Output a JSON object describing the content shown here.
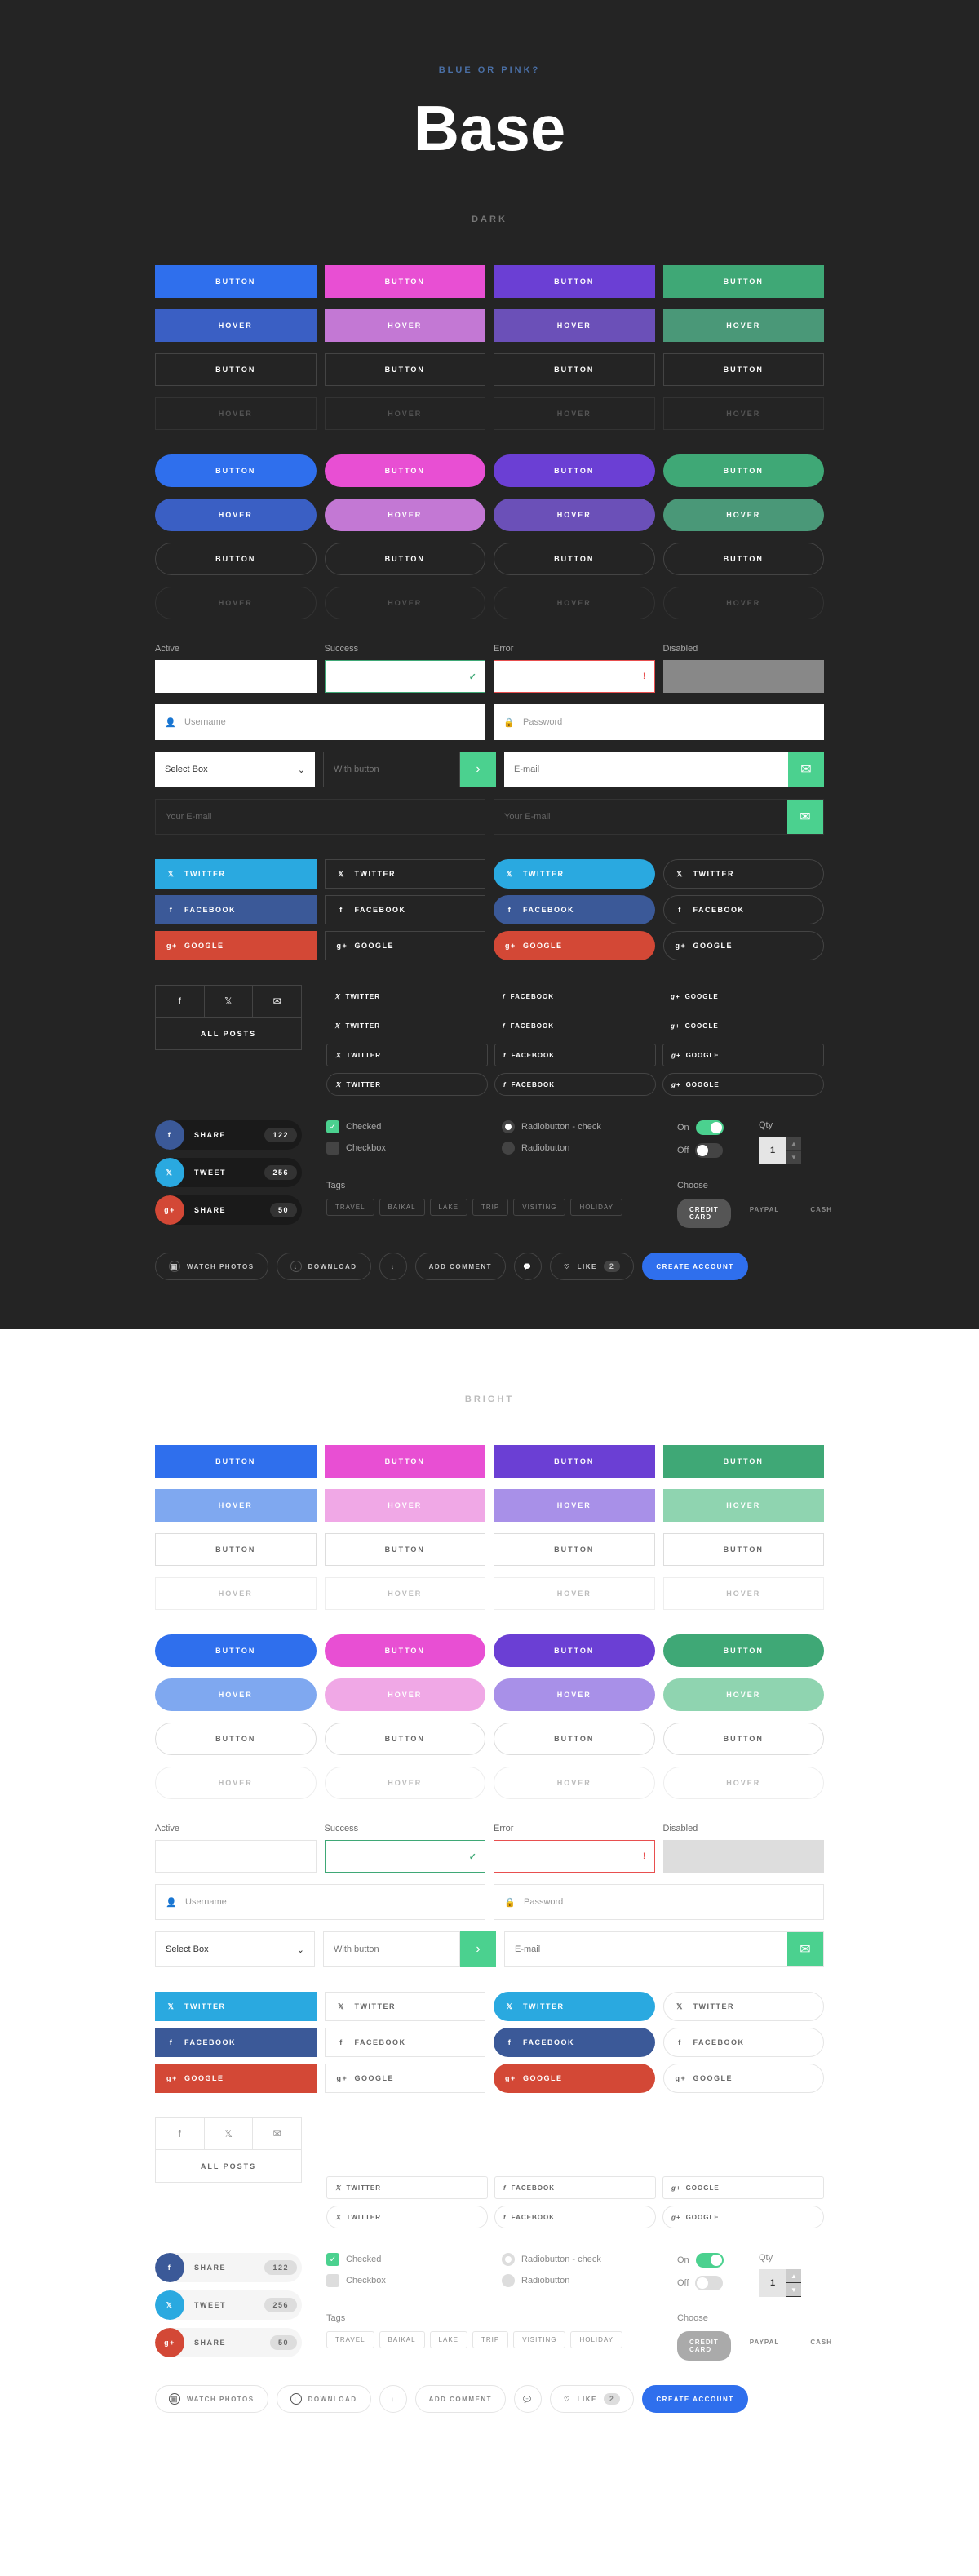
{
  "header": {
    "subtitle": "BLUE OR PINK?",
    "title": "Base"
  },
  "sections": {
    "dark": "DARK",
    "bright": "BRIGHT"
  },
  "btn": {
    "button": "BUTTON",
    "hover": "HOVER"
  },
  "inputs": {
    "labels": {
      "active": "Active",
      "success": "Success",
      "error": "Error",
      "disabled": "Disabled"
    },
    "username": "Username",
    "password": "Password",
    "select": "Select Box",
    "with_button": "With button",
    "email": "E-mail",
    "your_email": "Your E-mail"
  },
  "social": {
    "twitter": "TWITTER",
    "facebook": "FACEBOOK",
    "google": "GOOGLE"
  },
  "tabs": {
    "all_posts": "ALL POSTS"
  },
  "share": {
    "share": "SHARE",
    "tweet": "TWEET",
    "counts": {
      "fb": "122",
      "tw": "256",
      "gp": "50"
    }
  },
  "controls": {
    "checked": "Checked",
    "checkbox": "Checkbox",
    "radio_check": "Radiobutton - check",
    "radio": "Radiobutton",
    "on": "On",
    "off": "Off",
    "qty": "Qty",
    "qty_val": "1"
  },
  "tags": {
    "label": "Tags",
    "items": [
      "TRAVEL",
      "BAIKAL",
      "LAKE",
      "TRIP",
      "VISITING",
      "HOLIDAY"
    ]
  },
  "choose": {
    "label": "Choose",
    "items": [
      "CREDIT CARD",
      "PAYPAL",
      "CASH"
    ]
  },
  "actions": {
    "watch": "WATCH PHOTOS",
    "download": "DOWNLOAD",
    "add_comment": "ADD COMMENT",
    "like": "LIKE",
    "like_count": "2",
    "create": "CREATE ACCOUNT"
  }
}
